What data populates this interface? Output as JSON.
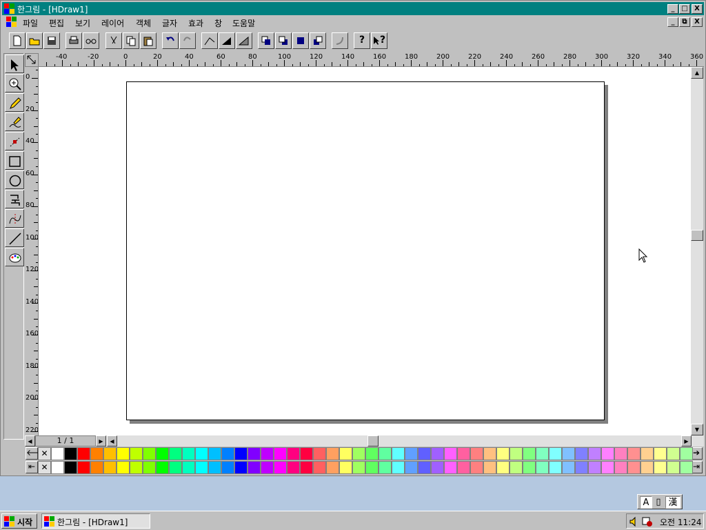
{
  "window": {
    "title": "한그림 - [HDraw1]",
    "caption_buttons": [
      "_",
      "□",
      "X"
    ],
    "doc_buttons": [
      "_",
      "⧉",
      "X"
    ]
  },
  "menu": [
    "파일",
    "편집",
    "보기",
    "레이어",
    "객체",
    "글자",
    "효과",
    "창",
    "도움말"
  ],
  "toolbar": {
    "help_label": "?",
    "context_help_label": "?"
  },
  "tools": [
    "select-arrow-icon",
    "zoom-icon",
    "pencil-icon",
    "freehand-icon",
    "node-edit-icon",
    "rectangle-icon",
    "ellipse-icon",
    "text-icon",
    "curve-icon",
    "line-icon",
    "palette-icon"
  ],
  "ruler": {
    "horizontal": [
      "-40",
      "-20",
      "0",
      "20",
      "40",
      "60",
      "80",
      "100",
      "120",
      "140",
      "160",
      "180",
      "200",
      "220",
      "240",
      "260",
      "280",
      "300",
      "320",
      "340",
      "360"
    ],
    "vertical": [
      "0",
      "20",
      "40",
      "60",
      "80",
      "100",
      "120",
      "140",
      "160",
      "180",
      "200",
      "220"
    ]
  },
  "page_indicator": "1 / 1",
  "palette": {
    "none_symbol": "✕",
    "row1": [
      "#ffffff",
      "#000000",
      "#ff0000",
      "#ff8000",
      "#ffbf00",
      "#ffff00",
      "#bfff00",
      "#80ff00",
      "#00ff00",
      "#00ff80",
      "#00ffbf",
      "#00ffff",
      "#00bfff",
      "#0080ff",
      "#0000ff",
      "#8000ff",
      "#bf00ff",
      "#ff00ff",
      "#ff0080",
      "#ff0040",
      "#ff6060",
      "#ffa060",
      "#ffff60",
      "#a0ff60",
      "#60ff60",
      "#60ffa0",
      "#60ffff",
      "#60a0ff",
      "#6060ff",
      "#a060ff",
      "#ff60ff",
      "#ff60a0",
      "#ff8080",
      "#ffc080",
      "#ffff80",
      "#c0ff80",
      "#80ff80",
      "#80ffc0",
      "#80ffff",
      "#80c0ff",
      "#8080ff",
      "#c080ff",
      "#ff80ff",
      "#ff80c0",
      "#ff9090",
      "#ffd090",
      "#ffff90",
      "#d0ff90",
      "#a0ffa0"
    ],
    "row2": [
      "#ffffff",
      "#000000",
      "#ff0000",
      "#ff8000",
      "#ffbf00",
      "#ffff00",
      "#bfff00",
      "#80ff00",
      "#00ff00",
      "#00ff80",
      "#00ffbf",
      "#00ffff",
      "#00bfff",
      "#0080ff",
      "#0000ff",
      "#8000ff",
      "#bf00ff",
      "#ff00ff",
      "#ff0080",
      "#ff0040",
      "#ff6060",
      "#ffa060",
      "#ffff60",
      "#a0ff60",
      "#60ff60",
      "#60ffa0",
      "#60ffff",
      "#60a0ff",
      "#6060ff",
      "#a060ff",
      "#ff60ff",
      "#ff60a0",
      "#ff8080",
      "#ffc080",
      "#ffff80",
      "#c0ff80",
      "#80ff80",
      "#80ffc0",
      "#80ffff",
      "#80c0ff",
      "#8080ff",
      "#c080ff",
      "#ff80ff",
      "#ff80c0",
      "#ff9090",
      "#ffd090",
      "#ffff90",
      "#d0ff90",
      "#a0ffa0"
    ]
  },
  "ime": [
    "A",
    "漢"
  ],
  "taskbar": {
    "start_label": "시작",
    "task_label": "한그림 - [HDraw1]",
    "clock": "오전 11:24"
  },
  "colors": {
    "titlebar": "#008080",
    "face": "#c0c0c0",
    "desktop": "#b4c8e0"
  }
}
